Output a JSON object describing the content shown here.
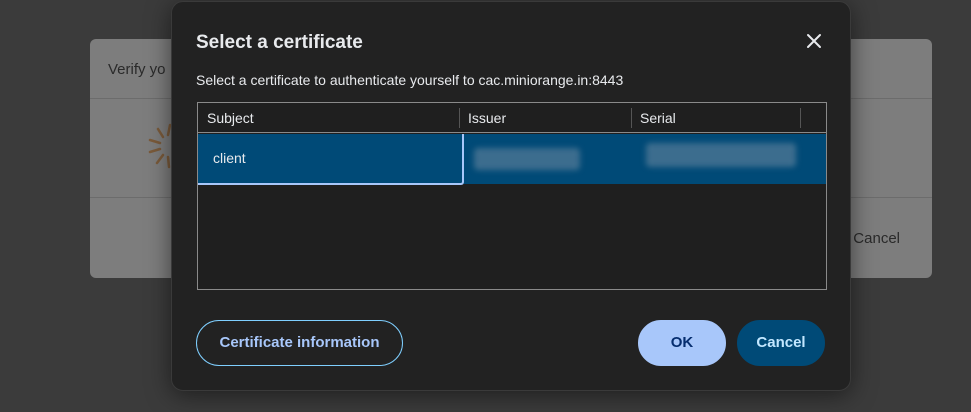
{
  "background": {
    "title": "Verify yo",
    "cancel_label": "Cancel"
  },
  "dialog": {
    "title": "Select a certificate",
    "subtitle": "Select a certificate to authenticate yourself to cac.miniorange.in:8443",
    "table": {
      "columns": [
        "Subject",
        "Issuer",
        "Serial"
      ],
      "rows": [
        {
          "subject": "client",
          "issuer": "",
          "serial": "",
          "selected": true
        }
      ]
    },
    "buttons": {
      "info_label": "Certificate information",
      "ok_label": "OK",
      "cancel_label": "Cancel"
    }
  },
  "icons": {
    "close": "close-icon",
    "spinner": "loading-spinner-icon"
  },
  "colors": {
    "accent": "#a8c7fa",
    "selected_row": "#004a77",
    "dialog_bg": "#222222"
  }
}
